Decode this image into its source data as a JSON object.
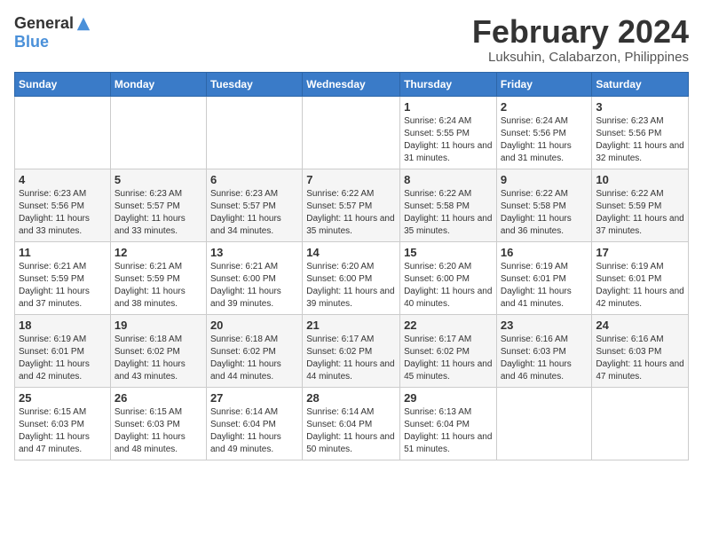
{
  "logo": {
    "general": "General",
    "blue": "Blue"
  },
  "title": {
    "month": "February 2024",
    "location": "Luksuhin, Calabarzon, Philippines"
  },
  "headers": [
    "Sunday",
    "Monday",
    "Tuesday",
    "Wednesday",
    "Thursday",
    "Friday",
    "Saturday"
  ],
  "weeks": [
    [
      {
        "day": "",
        "details": ""
      },
      {
        "day": "",
        "details": ""
      },
      {
        "day": "",
        "details": ""
      },
      {
        "day": "",
        "details": ""
      },
      {
        "day": "1",
        "details": "Sunrise: 6:24 AM\nSunset: 5:55 PM\nDaylight: 11 hours and 31 minutes."
      },
      {
        "day": "2",
        "details": "Sunrise: 6:24 AM\nSunset: 5:56 PM\nDaylight: 11 hours and 31 minutes."
      },
      {
        "day": "3",
        "details": "Sunrise: 6:23 AM\nSunset: 5:56 PM\nDaylight: 11 hours and 32 minutes."
      }
    ],
    [
      {
        "day": "4",
        "details": "Sunrise: 6:23 AM\nSunset: 5:56 PM\nDaylight: 11 hours and 33 minutes."
      },
      {
        "day": "5",
        "details": "Sunrise: 6:23 AM\nSunset: 5:57 PM\nDaylight: 11 hours and 33 minutes."
      },
      {
        "day": "6",
        "details": "Sunrise: 6:23 AM\nSunset: 5:57 PM\nDaylight: 11 hours and 34 minutes."
      },
      {
        "day": "7",
        "details": "Sunrise: 6:22 AM\nSunset: 5:57 PM\nDaylight: 11 hours and 35 minutes."
      },
      {
        "day": "8",
        "details": "Sunrise: 6:22 AM\nSunset: 5:58 PM\nDaylight: 11 hours and 35 minutes."
      },
      {
        "day": "9",
        "details": "Sunrise: 6:22 AM\nSunset: 5:58 PM\nDaylight: 11 hours and 36 minutes."
      },
      {
        "day": "10",
        "details": "Sunrise: 6:22 AM\nSunset: 5:59 PM\nDaylight: 11 hours and 37 minutes."
      }
    ],
    [
      {
        "day": "11",
        "details": "Sunrise: 6:21 AM\nSunset: 5:59 PM\nDaylight: 11 hours and 37 minutes."
      },
      {
        "day": "12",
        "details": "Sunrise: 6:21 AM\nSunset: 5:59 PM\nDaylight: 11 hours and 38 minutes."
      },
      {
        "day": "13",
        "details": "Sunrise: 6:21 AM\nSunset: 6:00 PM\nDaylight: 11 hours and 39 minutes."
      },
      {
        "day": "14",
        "details": "Sunrise: 6:20 AM\nSunset: 6:00 PM\nDaylight: 11 hours and 39 minutes."
      },
      {
        "day": "15",
        "details": "Sunrise: 6:20 AM\nSunset: 6:00 PM\nDaylight: 11 hours and 40 minutes."
      },
      {
        "day": "16",
        "details": "Sunrise: 6:19 AM\nSunset: 6:01 PM\nDaylight: 11 hours and 41 minutes."
      },
      {
        "day": "17",
        "details": "Sunrise: 6:19 AM\nSunset: 6:01 PM\nDaylight: 11 hours and 42 minutes."
      }
    ],
    [
      {
        "day": "18",
        "details": "Sunrise: 6:19 AM\nSunset: 6:01 PM\nDaylight: 11 hours and 42 minutes."
      },
      {
        "day": "19",
        "details": "Sunrise: 6:18 AM\nSunset: 6:02 PM\nDaylight: 11 hours and 43 minutes."
      },
      {
        "day": "20",
        "details": "Sunrise: 6:18 AM\nSunset: 6:02 PM\nDaylight: 11 hours and 44 minutes."
      },
      {
        "day": "21",
        "details": "Sunrise: 6:17 AM\nSunset: 6:02 PM\nDaylight: 11 hours and 44 minutes."
      },
      {
        "day": "22",
        "details": "Sunrise: 6:17 AM\nSunset: 6:02 PM\nDaylight: 11 hours and 45 minutes."
      },
      {
        "day": "23",
        "details": "Sunrise: 6:16 AM\nSunset: 6:03 PM\nDaylight: 11 hours and 46 minutes."
      },
      {
        "day": "24",
        "details": "Sunrise: 6:16 AM\nSunset: 6:03 PM\nDaylight: 11 hours and 47 minutes."
      }
    ],
    [
      {
        "day": "25",
        "details": "Sunrise: 6:15 AM\nSunset: 6:03 PM\nDaylight: 11 hours and 47 minutes."
      },
      {
        "day": "26",
        "details": "Sunrise: 6:15 AM\nSunset: 6:03 PM\nDaylight: 11 hours and 48 minutes."
      },
      {
        "day": "27",
        "details": "Sunrise: 6:14 AM\nSunset: 6:04 PM\nDaylight: 11 hours and 49 minutes."
      },
      {
        "day": "28",
        "details": "Sunrise: 6:14 AM\nSunset: 6:04 PM\nDaylight: 11 hours and 50 minutes."
      },
      {
        "day": "29",
        "details": "Sunrise: 6:13 AM\nSunset: 6:04 PM\nDaylight: 11 hours and 51 minutes."
      },
      {
        "day": "",
        "details": ""
      },
      {
        "day": "",
        "details": ""
      }
    ]
  ]
}
